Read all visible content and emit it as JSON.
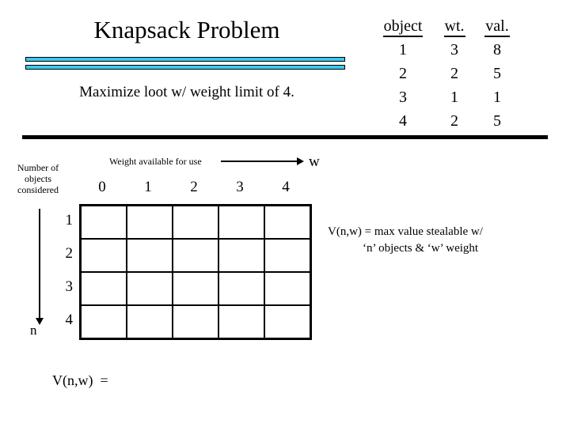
{
  "slide": {
    "title": "Knapsack Problem",
    "subtitle": "Maximize loot w/ weight limit of 4.",
    "accent_color": "#3cc8f0",
    "rule_color": "#000000"
  },
  "object_table": {
    "headers": [
      "object",
      "wt.",
      "val."
    ],
    "rows": [
      [
        "1",
        "3",
        "8"
      ],
      [
        "2",
        "2",
        "5"
      ],
      [
        "3",
        "1",
        "1"
      ],
      [
        "4",
        "2",
        "5"
      ]
    ]
  },
  "axes": {
    "row_axis_caption": "Number of objects considered",
    "row_axis_caption_lines": [
      "Number of",
      "objects",
      "considered"
    ],
    "row_axis_symbol": "n",
    "col_axis_caption": "Weight available for use",
    "col_axis_symbol": "w"
  },
  "grid": {
    "column_headers": [
      "0",
      "1",
      "2",
      "3",
      "4"
    ],
    "row_headers": [
      "1",
      "2",
      "3",
      "4"
    ],
    "cells": [
      [
        "",
        "",
        "",
        "",
        ""
      ],
      [
        "",
        "",
        "",
        "",
        ""
      ],
      [
        "",
        "",
        "",
        "",
        ""
      ],
      [
        "",
        "",
        "",
        "",
        ""
      ]
    ]
  },
  "definition": {
    "line1": "V(n,w) = max value stealable w/",
    "line2": "‘n’ objects & ‘w’ weight"
  },
  "bottom": {
    "expression": "V(n,w)  ="
  }
}
